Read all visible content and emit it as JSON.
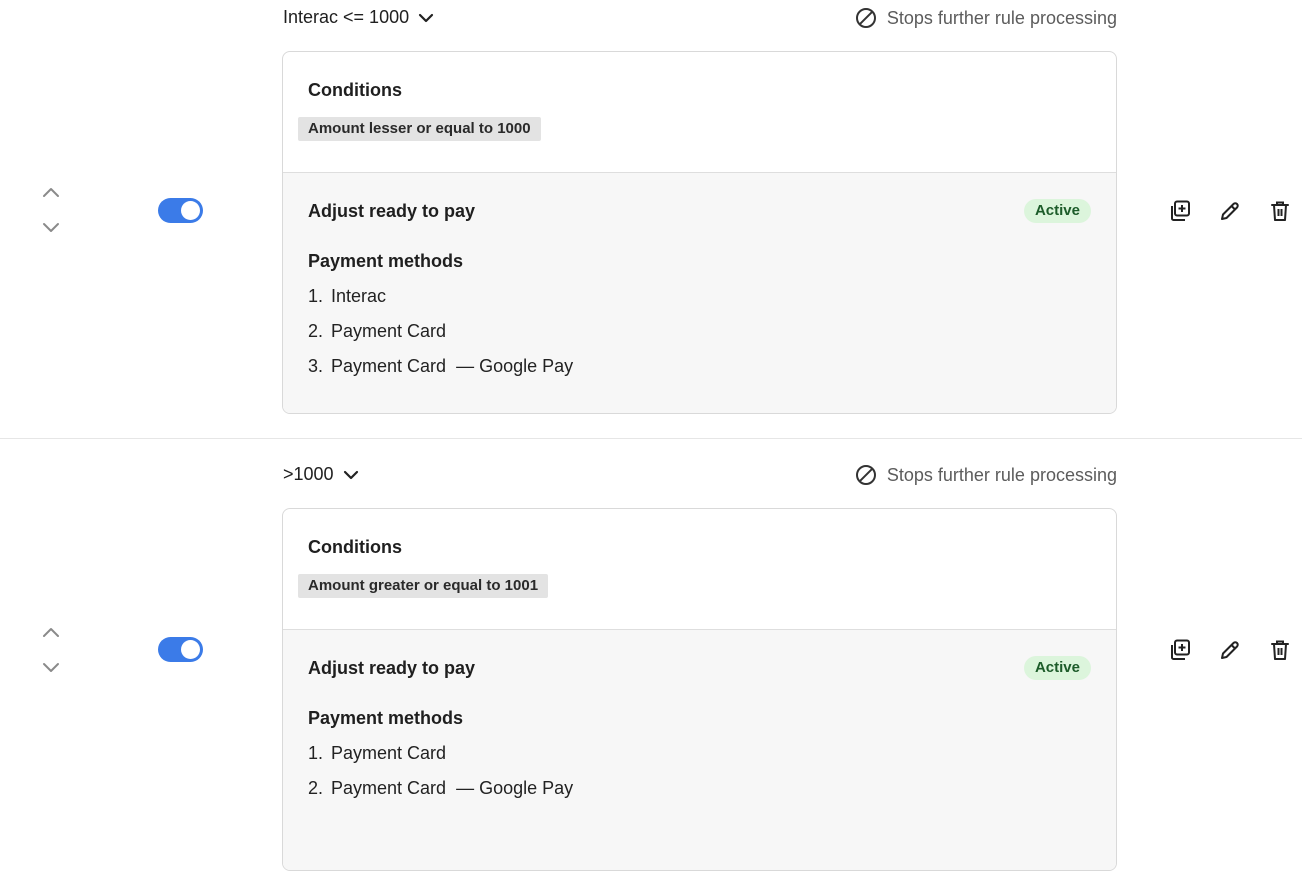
{
  "rules": [
    {
      "title": "Interac <= 1000",
      "stops_label": "Stops further rule processing",
      "conditions_label": "Conditions",
      "condition_chip": "Amount lesser or equal to 1000",
      "action_title": "Adjust ready to pay",
      "status": "Active",
      "payment_methods_label": "Payment methods",
      "methods": [
        {
          "num": "1.",
          "name": "Interac",
          "sub": ""
        },
        {
          "num": "2.",
          "name": "Payment Card",
          "sub": ""
        },
        {
          "num": "3.",
          "name": "Payment Card",
          "sub": "— Google Pay"
        }
      ],
      "enabled": true
    },
    {
      "title": ">1000",
      "stops_label": "Stops further rule processing",
      "conditions_label": "Conditions",
      "condition_chip": "Amount greater or equal to 1001",
      "action_title": "Adjust ready to pay",
      "status": "Active",
      "payment_methods_label": "Payment methods",
      "methods": [
        {
          "num": "1.",
          "name": "Payment Card",
          "sub": ""
        },
        {
          "num": "2.",
          "name": "Payment Card",
          "sub": "— Google Pay"
        }
      ],
      "enabled": true
    }
  ],
  "colors": {
    "toggle_on": "#3b7be8",
    "badge_bg": "#dcf5dc",
    "badge_text": "#1d5c2a",
    "chip_bg": "#e3e3e3"
  },
  "icons": [
    "chevron-up-icon",
    "chevron-down-icon",
    "duplicate-icon",
    "pencil-icon",
    "trash-icon",
    "prohibited-icon"
  ]
}
